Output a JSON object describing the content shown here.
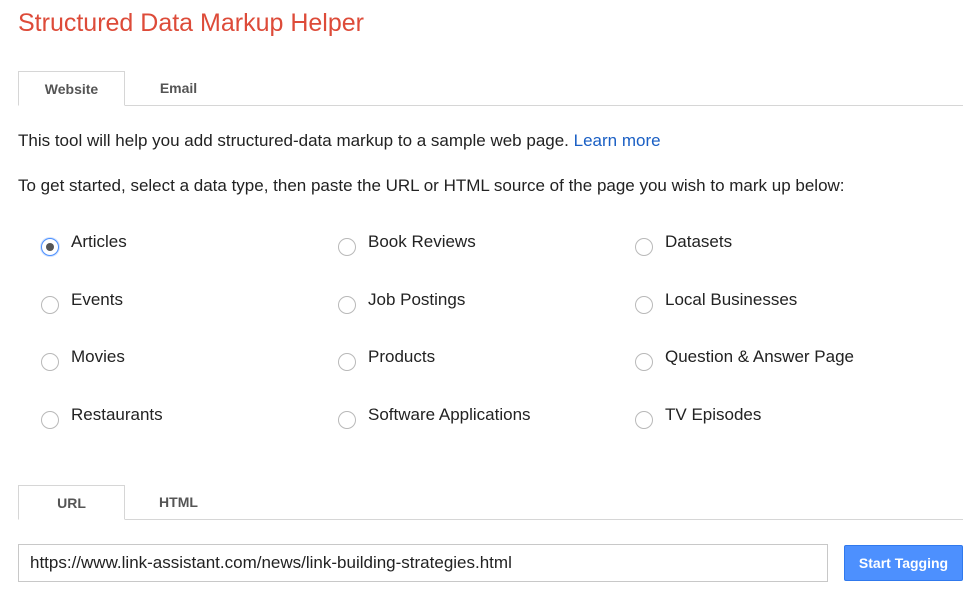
{
  "title": "Structured Data Markup Helper",
  "source_tabs": [
    {
      "label": "Website",
      "active": true
    },
    {
      "label": "Email",
      "active": false
    }
  ],
  "intro": {
    "text": "This tool will help you add structured-data markup to a sample web page. ",
    "link_label": "Learn more"
  },
  "instructions": "To get started, select a data type, then paste the URL or HTML source of the page you wish to mark up below:",
  "data_types": [
    {
      "label": "Articles",
      "checked": true
    },
    {
      "label": "Book Reviews",
      "checked": false
    },
    {
      "label": "Datasets",
      "checked": false
    },
    {
      "label": "Events",
      "checked": false
    },
    {
      "label": "Job Postings",
      "checked": false
    },
    {
      "label": "Local Businesses",
      "checked": false
    },
    {
      "label": "Movies",
      "checked": false
    },
    {
      "label": "Products",
      "checked": false
    },
    {
      "label": "Question & Answer Page",
      "checked": false
    },
    {
      "label": "Restaurants",
      "checked": false
    },
    {
      "label": "Software Applications",
      "checked": false
    },
    {
      "label": "TV Episodes",
      "checked": false
    }
  ],
  "input_tabs": [
    {
      "label": "URL",
      "active": true
    },
    {
      "label": "HTML",
      "active": false
    }
  ],
  "url_input": {
    "value": "https://www.link-assistant.com/news/link-building-strategies.html"
  },
  "start_button_label": "Start Tagging",
  "colors": {
    "title": "#dd4b39",
    "link": "#1a5fc4",
    "primary_button": "#4d90fe"
  }
}
